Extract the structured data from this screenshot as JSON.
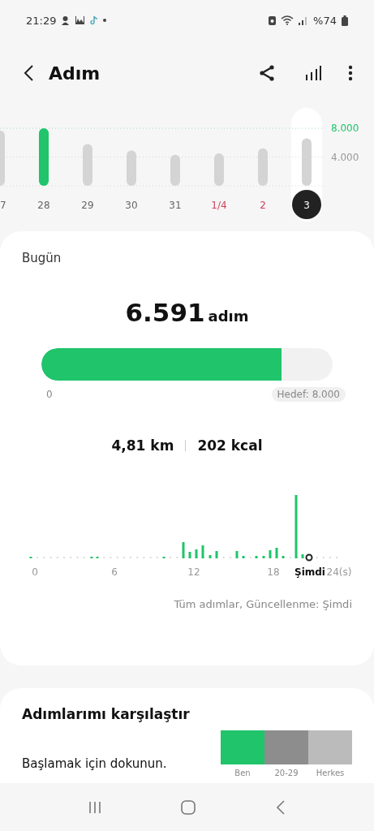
{
  "status_bar": {
    "time": "21:29",
    "battery": "%74"
  },
  "header": {
    "title": "Adım"
  },
  "daily_chart": {
    "chart_data": {
      "type": "bar",
      "stacked": true,
      "categories": [
        "7",
        "28",
        "29",
        "30",
        "31",
        "1/4",
        "2",
        "3"
      ],
      "series": [
        {
          "color": "#d4d4d4",
          "values": [
            7700,
            null,
            5800,
            4900,
            4300,
            4500,
            5200,
            6600
          ]
        },
        {
          "color": "#1fc46b",
          "values": [
            null,
            8000,
            null,
            null,
            null,
            null,
            null,
            null
          ]
        }
      ],
      "ylim": [
        0,
        8000
      ],
      "yticks": [
        {
          "value": 4000,
          "label": "4.000"
        },
        {
          "value": 8000,
          "label": "8.000"
        }
      ]
    },
    "days": [
      {
        "weekend": false,
        "selected": false
      },
      {
        "weekend": false,
        "selected": false
      },
      {
        "weekend": false,
        "selected": false
      },
      {
        "weekend": false,
        "selected": false
      },
      {
        "weekend": false,
        "selected": false
      },
      {
        "weekend": true,
        "selected": false
      },
      {
        "weekend": true,
        "selected": false
      },
      {
        "weekend": false,
        "selected": true
      }
    ]
  },
  "today": {
    "label": "Bugün",
    "steps": "6.591",
    "unit": "adım",
    "level": 0.824,
    "start_label": "0",
    "goal_label": "Hedef: 8.000",
    "distance": "4,81 km",
    "calories": "202 kcal",
    "hourly_axis": [
      {
        "label": "0",
        "kind": "tick"
      },
      {
        "label": "6",
        "kind": "tick"
      },
      {
        "label": "12",
        "kind": "tick"
      },
      {
        "label": "18",
        "kind": "tick"
      },
      {
        "label": "Şimdi",
        "kind": "now"
      },
      {
        "label": "24(s)",
        "kind": "tick"
      }
    ],
    "footer": "Tüm adımlar, Güncellenme: Şimdi"
  },
  "compare": {
    "title": "Adımlarımı karşılaştır",
    "hint": "Başlamak için dokunun.",
    "groups": [
      {
        "label": "Ben",
        "color": "#1fc46b"
      },
      {
        "label": "20-29",
        "color": "#8d8d8d"
      },
      {
        "label": "Herkes",
        "color": "#bbbbbb"
      }
    ]
  }
}
